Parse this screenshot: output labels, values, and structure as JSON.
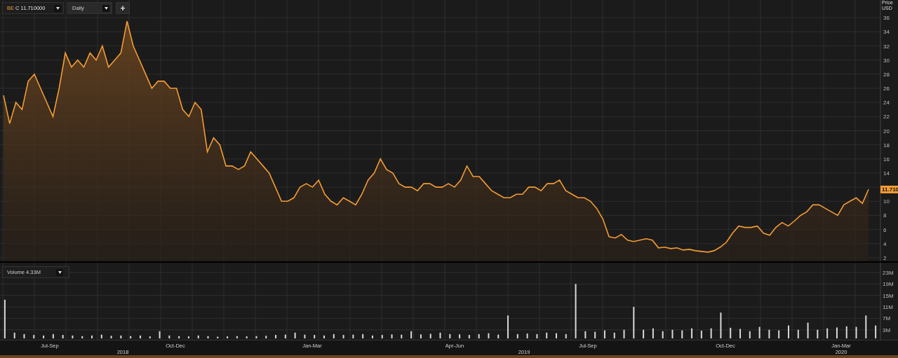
{
  "toolbar": {
    "symbol": "BE",
    "quote": "C 11.710000",
    "interval": "Daily",
    "add_button": "+"
  },
  "price_chart": {
    "last_price_label": "11.710",
    "chart_data": {
      "type": "area",
      "grid": true,
      "ylabel": "Price USD",
      "ylim": [
        1.5,
        38.5
      ],
      "yticks": [
        {
          "value": 2,
          "label": "2"
        },
        {
          "value": 4,
          "label": "4"
        },
        {
          "value": 6,
          "label": "6"
        },
        {
          "value": 8,
          "label": "8"
        },
        {
          "value": 10,
          "label": "10"
        },
        {
          "value": 14,
          "label": "14"
        },
        {
          "value": 16,
          "label": "16"
        },
        {
          "value": 18,
          "label": "18"
        },
        {
          "value": 20,
          "label": "20"
        },
        {
          "value": 22,
          "label": "22"
        },
        {
          "value": 24,
          "label": "24"
        },
        {
          "value": 26,
          "label": "26"
        },
        {
          "value": 28,
          "label": "28"
        },
        {
          "value": 30,
          "label": "30"
        },
        {
          "value": 32,
          "label": "32"
        },
        {
          "value": 34,
          "label": "34"
        },
        {
          "value": 36,
          "label": "36"
        }
      ],
      "categories": [
        null,
        null,
        null,
        null,
        null,
        null,
        null,
        null,
        null,
        null,
        null,
        null,
        null,
        null,
        null,
        null,
        null,
        null,
        null,
        null,
        null,
        null,
        null,
        null,
        null,
        null,
        null,
        null,
        null,
        null,
        null,
        null,
        null,
        null,
        null,
        null,
        null,
        null,
        null,
        null,
        null,
        null,
        null,
        null,
        null,
        null,
        null,
        null,
        null,
        null,
        null,
        null,
        null,
        null,
        null,
        null,
        null,
        null,
        null,
        null,
        null,
        null,
        null,
        null,
        null,
        null,
        null,
        null,
        null,
        null,
        null,
        null,
        null,
        null,
        null,
        null,
        null,
        null,
        null,
        null,
        null,
        null,
        null,
        null,
        null,
        null,
        null,
        null,
        null,
        null,
        null,
        null,
        null,
        null,
        null,
        null,
        null,
        null,
        null,
        null,
        null,
        null,
        null,
        null,
        null,
        null,
        null,
        null,
        null,
        null,
        null,
        null,
        null,
        null,
        null,
        null,
        null,
        null,
        null,
        null,
        null,
        null,
        null,
        null,
        null,
        null,
        null,
        null,
        null,
        null,
        null,
        null,
        null,
        null,
        null,
        null,
        null,
        null,
        null,
        null,
        null
      ],
      "series": [
        {
          "color": "#f39c34",
          "values": [
            25,
            21,
            24,
            23,
            27,
            28,
            26,
            24,
            22,
            26,
            31,
            29,
            30,
            29,
            31,
            30,
            32,
            29,
            30,
            31,
            35.5,
            32,
            30,
            28,
            26,
            27,
            27,
            26,
            26,
            23,
            22,
            24,
            23,
            17,
            19,
            18,
            15,
            15,
            14.5,
            15,
            17,
            16,
            15,
            14,
            12,
            10,
            10,
            10.5,
            12,
            12.5,
            12,
            13,
            11,
            10,
            9.5,
            10.5,
            10,
            9.5,
            11,
            13,
            14,
            16,
            14.5,
            14,
            12.5,
            12,
            12,
            11.5,
            12.5,
            12.5,
            12,
            12,
            12.5,
            12,
            13,
            15,
            13.5,
            13.5,
            12.5,
            11.5,
            11,
            10.5,
            10.5,
            11,
            11,
            12,
            12,
            11.5,
            12.5,
            12.5,
            13,
            11.5,
            11,
            10.5,
            10.5,
            10,
            9,
            7.5,
            5,
            4.8,
            5.3,
            4.5,
            4.3,
            4.5,
            4.7,
            4.5,
            3.4,
            3.5,
            3.3,
            3.4,
            3.1,
            3.2,
            3,
            2.9,
            2.8,
            3,
            3.5,
            4.2,
            5.5,
            6.5,
            6.3,
            6.3,
            6.5,
            5.5,
            5.2,
            6.3,
            7,
            6.5,
            7.2,
            8,
            8.5,
            9.5,
            9.5,
            9,
            8.5,
            8,
            9.5,
            10,
            10.5,
            9.7,
            11.7
          ]
        }
      ]
    }
  },
  "volume_chart": {
    "selector": "Volume 4.33M",
    "chart_data": {
      "type": "bar",
      "grid": true,
      "ylim": [
        0,
        26.4
      ],
      "yticks": [
        {
          "value": 3,
          "label": "3M"
        },
        {
          "value": 7,
          "label": "7M"
        },
        {
          "value": 11,
          "label": "11M"
        },
        {
          "value": 15,
          "label": "15M"
        },
        {
          "value": 19,
          "label": "19M"
        },
        {
          "value": 23,
          "label": "23M"
        }
      ],
      "categories": [
        null,
        null,
        null,
        null,
        null,
        null,
        null,
        null,
        null,
        null,
        null,
        null,
        null,
        null,
        null,
        null,
        null,
        null,
        null,
        null,
        null,
        null,
        null,
        null,
        null,
        null,
        null,
        null,
        null,
        null,
        null,
        null,
        null,
        null,
        null,
        null,
        null,
        null,
        null,
        null,
        null,
        null,
        null,
        null,
        null,
        null,
        null,
        null,
        null,
        null,
        null,
        null,
        null,
        null,
        null,
        null,
        null,
        null,
        null,
        null,
        null,
        null,
        null,
        null,
        null,
        null,
        null,
        null,
        null,
        null,
        null,
        null,
        null,
        null,
        null,
        null,
        null,
        null,
        null,
        null,
        null,
        null,
        null,
        null,
        null,
        null,
        null,
        null,
        null,
        null,
        null
      ],
      "series": [
        {
          "color": "#d8d8d8",
          "values": [
            13.5,
            2,
            1.5,
            1.2,
            1,
            1.5,
            1.2,
            1,
            0.8,
            1,
            1.3,
            0.9,
            1,
            0.8,
            1,
            0.7,
            2.5,
            1,
            0.8,
            0.7,
            1,
            0.8,
            0.6,
            0.7,
            0.8,
            0.7,
            0.8,
            0.9,
            1.2,
            1.3,
            2,
            1.3,
            1.2,
            1,
            1.5,
            1.2,
            1.3,
            1.5,
            1,
            1.2,
            1.4,
            1.3,
            2.5,
            1.4,
            1.6,
            2,
            1.5,
            1.4,
            1.2,
            1.5,
            1.8,
            1.3,
            8,
            1.5,
            1.7,
            1.5,
            2,
            1.8,
            1.5,
            19,
            2.5,
            2.3,
            2.8,
            2,
            3,
            11,
            3,
            3.5,
            2.5,
            3,
            2.8,
            3.5,
            2.7,
            3.5,
            9,
            3.7,
            3.3,
            2.5,
            4,
            3,
            2.8,
            4.5,
            3,
            5.5,
            3,
            3.5,
            3.8,
            4.2,
            4,
            8,
            4.5
          ]
        }
      ]
    }
  },
  "time_axis": {
    "quarters": [
      "Jul-Sep",
      "Oct-Dec",
      "Jan-Mar",
      "Apr-Jun",
      "Jul-Sep",
      "Oct-Dec",
      "Jan-Mar"
    ],
    "years": [
      "2018",
      "2019",
      "2020"
    ]
  }
}
